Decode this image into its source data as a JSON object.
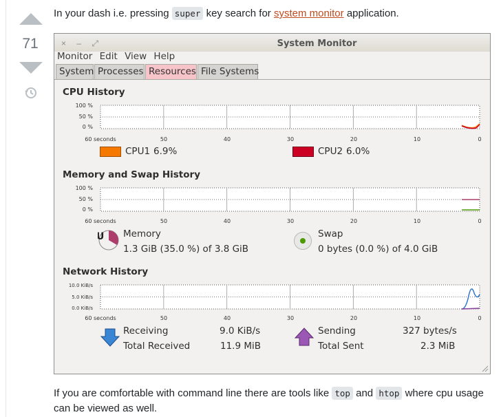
{
  "vote": {
    "count": "71"
  },
  "answer": {
    "intro_before_code": "In your dash i.e. pressing ",
    "intro_code": "super",
    "intro_mid": " key search for ",
    "intro_link": "system monitor",
    "intro_after": " application.",
    "outro_before": "If you are comfortable with command line there are tools like ",
    "outro_code1": "top",
    "outro_and": " and ",
    "outro_code2": "htop",
    "outro_after": " where cpu usage can be viewed as well."
  },
  "window": {
    "title": "System Monitor",
    "controls": "× – ⤢",
    "menu": [
      "Monitor",
      "Edit",
      "View",
      "Help"
    ],
    "tabs": [
      "System",
      "Processes",
      "Resources",
      "File Systems"
    ],
    "active_tab": "Resources"
  },
  "cpu": {
    "title": "CPU History",
    "y_ticks": [
      "100 %",
      "50 %",
      "0 %"
    ],
    "x_ticks": [
      "60 seconds",
      "50",
      "40",
      "30",
      "20",
      "10",
      "0"
    ],
    "legend": [
      {
        "name": "CPU1",
        "value": "6.9%",
        "color": "#f57900"
      },
      {
        "name": "CPU2",
        "value": "6.0%",
        "color": "#cc0022"
      }
    ]
  },
  "memory": {
    "title": "Memory and Swap History",
    "y_ticks": [
      "100 %",
      "50 %",
      "0 %"
    ],
    "x_ticks": [
      "60 seconds",
      "50",
      "40",
      "30",
      "20",
      "10",
      "0"
    ],
    "memory_label": "Memory",
    "memory_value": "1.3 GiB (35.0 %) of 3.8 GiB",
    "swap_label": "Swap",
    "swap_value": "0 bytes (0.0 %) of 4.0 GiB",
    "memory_color": "#ad3d6b",
    "swap_color": "#4e9a06"
  },
  "network": {
    "title": "Network History",
    "y_ticks": [
      "10.0 KiB/s",
      "5.0 KiB/s",
      "0.0 KiB/s"
    ],
    "x_ticks": [
      "60 seconds",
      "50",
      "40",
      "30",
      "20",
      "10",
      "0"
    ],
    "receiving_label": "Receiving",
    "receiving_value": "9.0 KiB/s",
    "total_received_label": "Total Received",
    "total_received_value": "11.9 MiB",
    "sending_label": "Sending",
    "sending_value": "327 bytes/s",
    "total_sent_label": "Total Sent",
    "total_sent_value": "2.3 MiB",
    "receiving_color": "#2e75c9",
    "sending_color": "#8a3fa0"
  }
}
